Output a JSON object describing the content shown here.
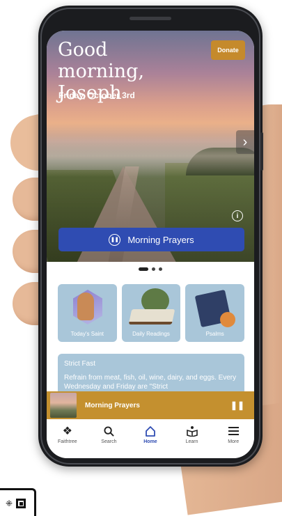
{
  "hero": {
    "greeting": "Good morning, Joseph",
    "date": "Friday, October 3rd",
    "donate_label": "Donate",
    "play_label": "Morning Prayers"
  },
  "tiles": [
    {
      "label": "Today's Saint"
    },
    {
      "label": "Daily Readings"
    },
    {
      "label": "Psalms"
    }
  ],
  "fast": {
    "title": "Strict Fast",
    "text": "Refrain from meat, fish, oil, wine, dairy, and eggs. Every Wednesday and Friday are \"Strict"
  },
  "player": {
    "title": "Morning Prayers"
  },
  "nav": {
    "items": [
      {
        "label": "Faithtree",
        "icon": "faithtree-icon"
      },
      {
        "label": "Search",
        "icon": "search-icon"
      },
      {
        "label": "Home",
        "icon": "home-icon",
        "active": true
      },
      {
        "label": "Learn",
        "icon": "learn-icon"
      },
      {
        "label": "More",
        "icon": "menu-icon"
      }
    ]
  },
  "colors": {
    "accent_blue": "#2f4cb2",
    "gold": "#c4902f",
    "tile_blue": "#a9c6d9"
  }
}
